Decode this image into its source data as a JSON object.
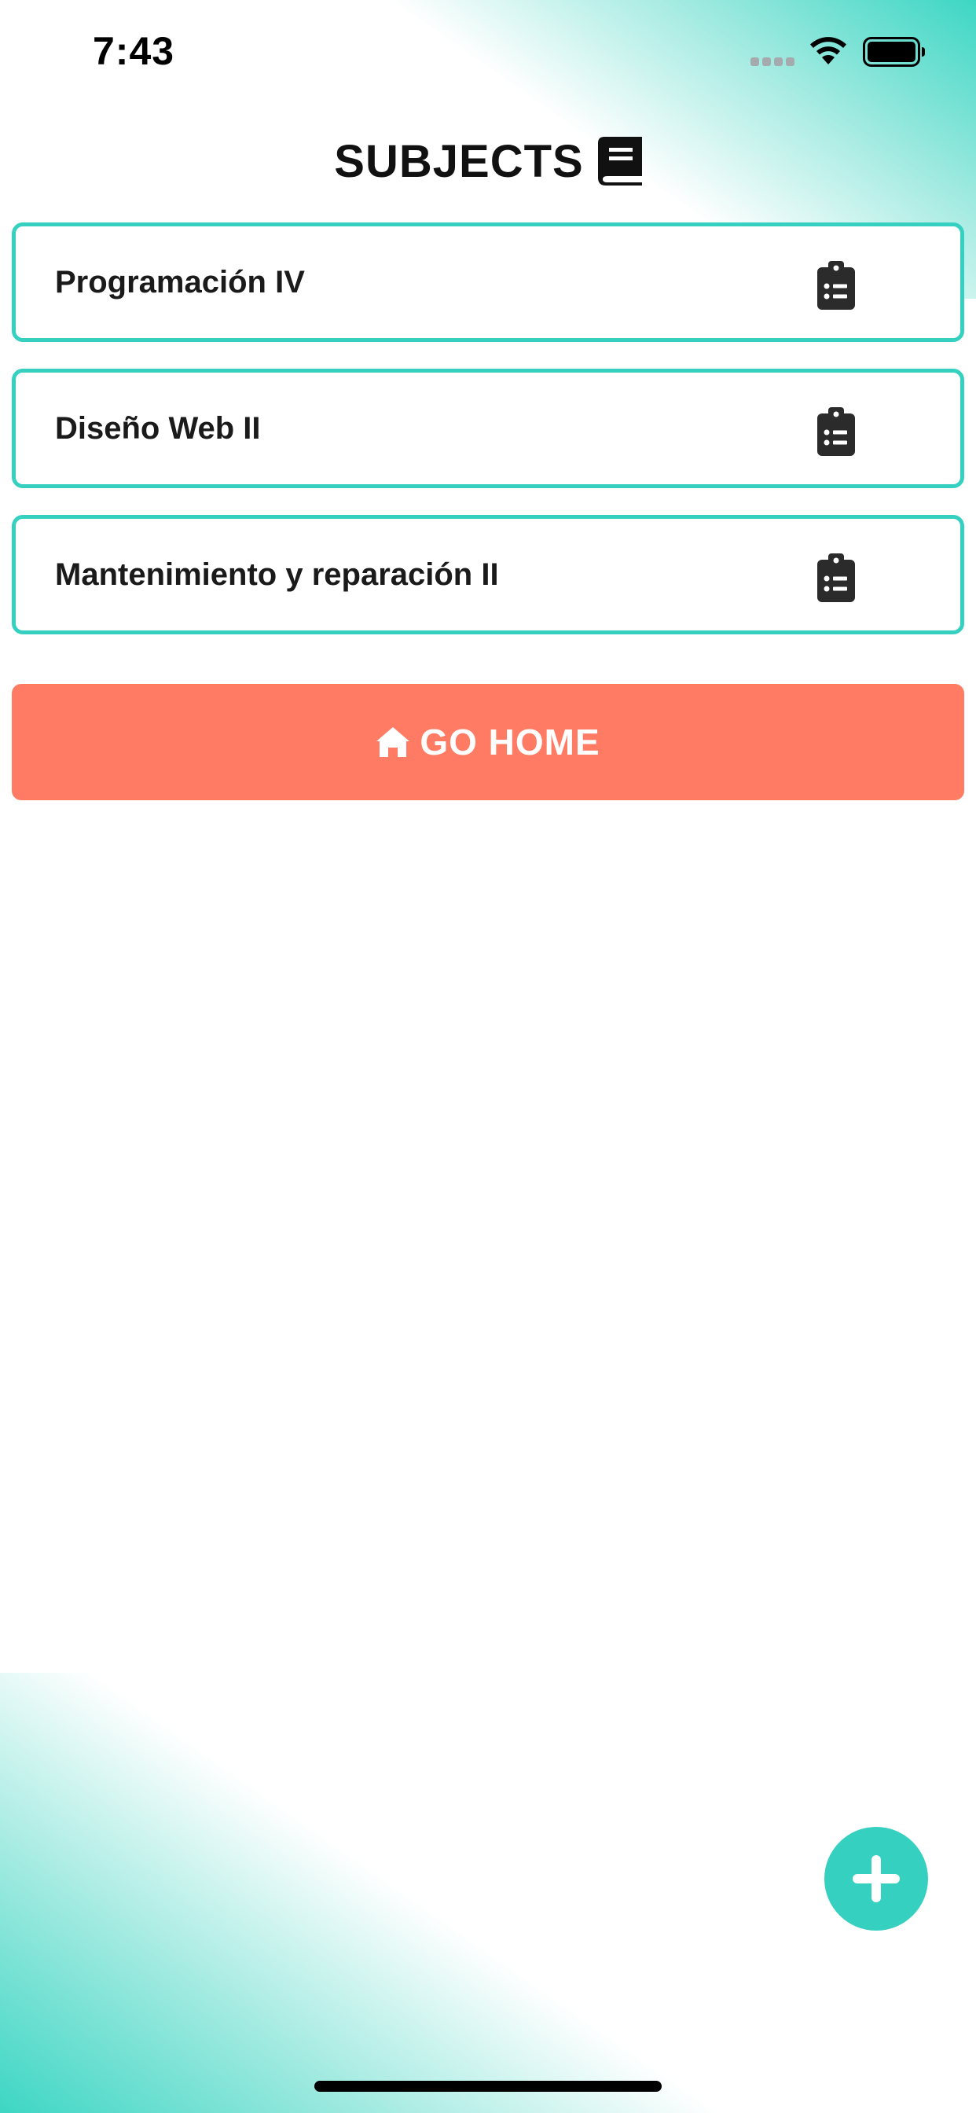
{
  "status_bar": {
    "time": "7:43"
  },
  "header": {
    "title": "SUBJECTS",
    "title_icon": "book-icon"
  },
  "subjects": [
    {
      "name": "Programación IV",
      "icon": "clipboard-list-icon"
    },
    {
      "name": "Diseño Web II",
      "icon": "clipboard-list-icon"
    },
    {
      "name": "Mantenimiento y reparación II",
      "icon": "clipboard-list-icon"
    }
  ],
  "go_home_button": {
    "label": "GO HOME",
    "icon": "home-icon",
    "color": "#ff7b63"
  },
  "fab": {
    "icon": "plus-icon",
    "color": "#35d0c0"
  },
  "colors": {
    "accent": "#35d0c0",
    "button": "#ff7b63",
    "text": "#111111"
  }
}
